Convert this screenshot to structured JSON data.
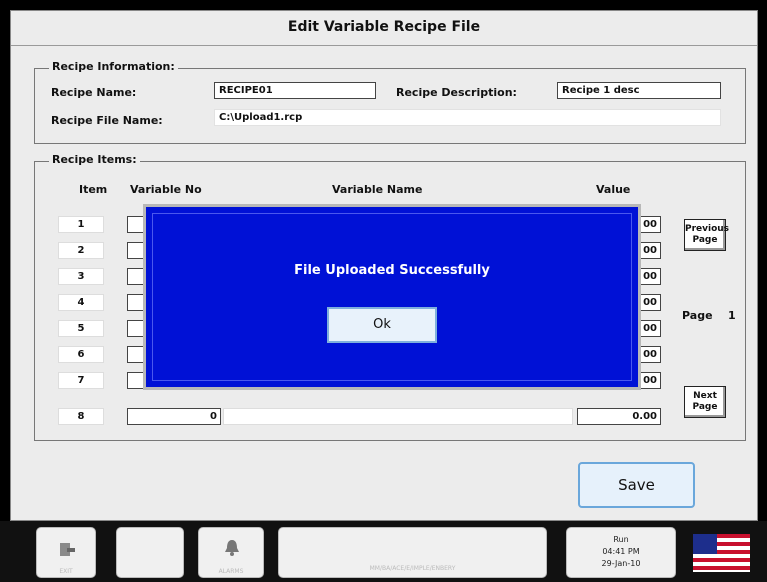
{
  "window": {
    "title": "Edit Variable Recipe File"
  },
  "recipe_info": {
    "legend": "Recipe Information:",
    "name_label": "Recipe Name:",
    "name_value": "RECIPE01",
    "desc_label": "Recipe Description:",
    "desc_value": "Recipe 1 desc",
    "file_label": "Recipe File Name:",
    "file_value": "C:\\Upload1.rcp"
  },
  "recipe_items": {
    "legend": "Recipe Items:",
    "headers": {
      "item": "Item",
      "var_no": "Variable No",
      "var_name": "Variable Name",
      "value": "Value"
    },
    "rows": [
      {
        "item": "1",
        "var_no": "",
        "value": "00"
      },
      {
        "item": "2",
        "var_no": "",
        "value": "00"
      },
      {
        "item": "3",
        "var_no": "",
        "value": "00"
      },
      {
        "item": "4",
        "var_no": "",
        "value": "00"
      },
      {
        "item": "5",
        "var_no": "",
        "value": "00"
      },
      {
        "item": "6",
        "var_no": "",
        "value": "00"
      },
      {
        "item": "7",
        "var_no": "",
        "value": "00"
      },
      {
        "item": "8",
        "var_no": "0",
        "value": "0.00"
      }
    ],
    "previous_page_label": "Previous\nPage",
    "next_page_label": "Next\nPage",
    "page_label": "Page",
    "page_number": "1"
  },
  "save_label": "Save",
  "dialog": {
    "message": "File Uploaded Successfully",
    "ok_label": "Ok"
  },
  "taskbar": {
    "btn1_label": "EXIT",
    "alarm_label": "ALARMS",
    "message_text": "MM/BA/ACE/E/IMPLE/ENBERY",
    "status_state": "Run",
    "status_time": "04:41 PM",
    "status_date": "29-Jan-10"
  },
  "colors": {
    "dialog_bg": "#0011d6",
    "save_border": "#6aa7db"
  }
}
